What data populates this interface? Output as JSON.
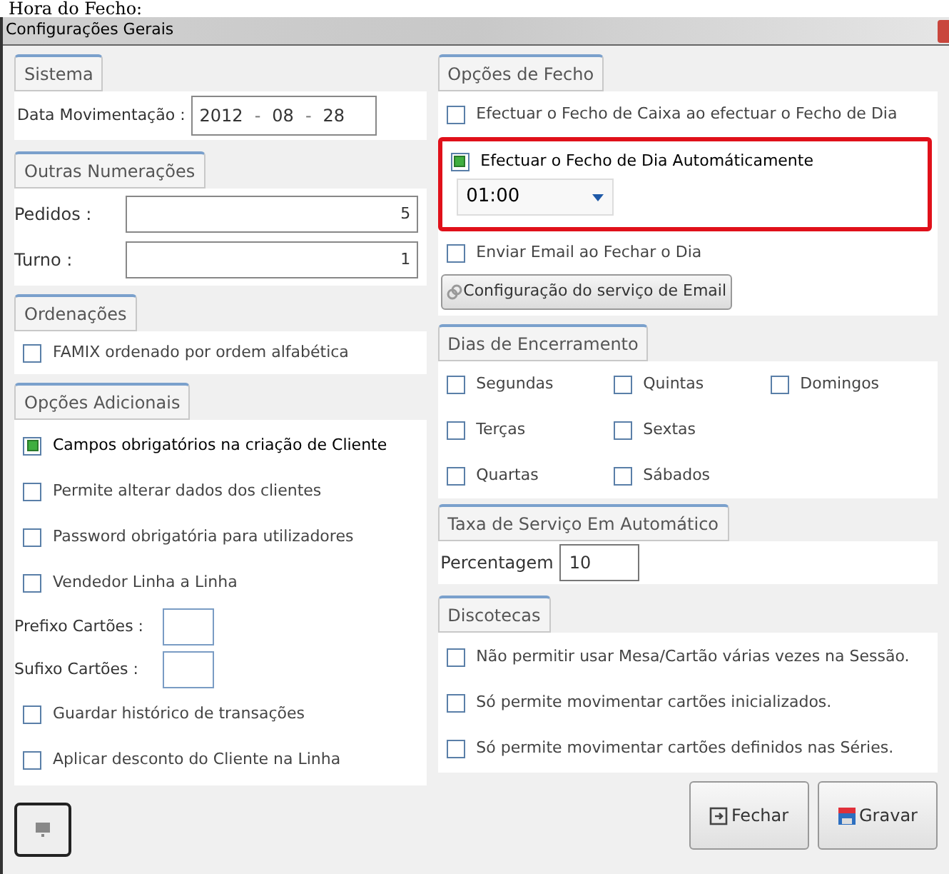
{
  "page_heading": "Hora do Fecho:",
  "window": {
    "title": "Configurações Gerais"
  },
  "left": {
    "sistema": {
      "title": "Sistema",
      "label": "Data Movimentação :",
      "date": [
        "2012",
        "08",
        "28"
      ],
      "separator": "-"
    },
    "outras": {
      "title": "Outras Numerações",
      "fields": [
        {
          "label": "Pedidos :",
          "value": "5"
        },
        {
          "label": "Turno :",
          "value": "1"
        }
      ]
    },
    "ordenacoes": {
      "title": "Ordenações",
      "items": [
        {
          "label": "FAMIX ordenado por ordem alfabética",
          "checked": false
        }
      ]
    },
    "adicionais": {
      "title": "Opções Adicionais",
      "items": [
        {
          "kind": "checkbox",
          "label": "Campos obrigatórios na criação  de Cliente",
          "checked": true
        },
        {
          "kind": "checkbox",
          "label": "Permite alterar dados dos clientes",
          "checked": false
        },
        {
          "kind": "checkbox",
          "label": "Password obrigatória para utilizadores",
          "checked": false
        },
        {
          "kind": "checkbox",
          "label": "Vendedor Linha a Linha",
          "checked": false
        },
        {
          "kind": "field",
          "label": "Prefixo Cartões :"
        },
        {
          "kind": "field",
          "label": "Sufixo Cartões :"
        },
        {
          "kind": "checkbox",
          "label": "Guardar histórico de transações",
          "checked": false
        },
        {
          "kind": "checkbox",
          "label": "Aplicar desconto do Cliente na Linha",
          "checked": false
        }
      ]
    }
  },
  "right": {
    "fecho": {
      "title": "Opções de Fecho",
      "caixa": {
        "label": "Efectuar o Fecho de Caixa ao efectuar o Fecho de Dia",
        "checked": false
      },
      "auto": {
        "label": "Efectuar o Fecho de Dia Automáticamente",
        "checked": true,
        "time": "01:00"
      },
      "email": {
        "label": "Enviar Email ao Fechar o Dia",
        "checked": false
      },
      "email_button": "Configuração do serviço de Email"
    },
    "dias": {
      "title": "Dias de Encerramento",
      "columns": [
        [
          {
            "label": "Segundas",
            "checked": false
          },
          {
            "label": "Terças",
            "checked": false
          },
          {
            "label": "Quartas",
            "checked": false
          }
        ],
        [
          {
            "label": "Quintas",
            "checked": false
          },
          {
            "label": "Sextas",
            "checked": false
          },
          {
            "label": "Sábados",
            "checked": false
          }
        ],
        [
          {
            "label": "Domingos",
            "checked": false
          }
        ]
      ]
    },
    "taxa": {
      "title": "Taxa de Serviço Em Automático",
      "label": "Percentagem",
      "value": "10"
    },
    "discotecas": {
      "title": "Discotecas",
      "items": [
        {
          "label": "Não permitir usar Mesa/Cartão várias vezes na Sessão.",
          "checked": false
        },
        {
          "label": "Só permite movimentar cartões inicializados.",
          "checked": false
        },
        {
          "label": "Só permite movimentar cartões definidos nas Séries.",
          "checked": false
        }
      ]
    }
  },
  "buttons": [
    "Fechar",
    "Gravar"
  ]
}
